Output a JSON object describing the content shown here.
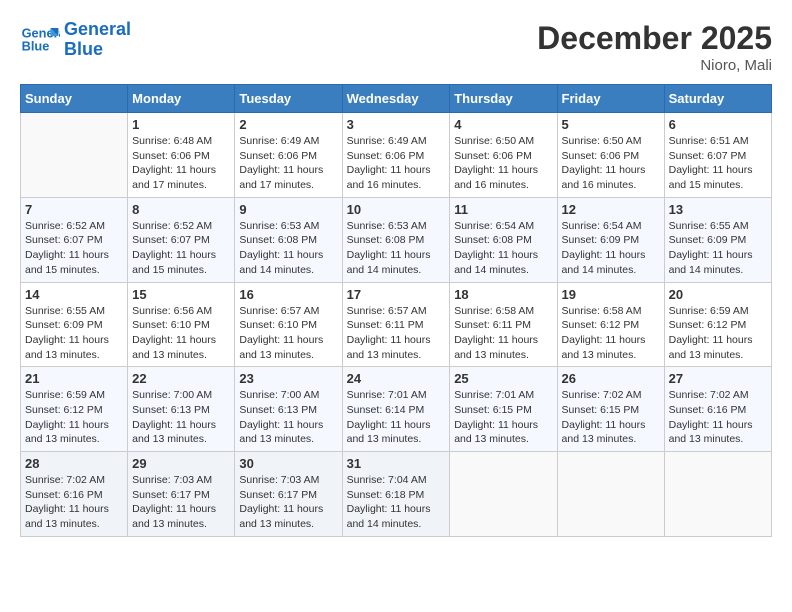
{
  "header": {
    "logo_line1": "General",
    "logo_line2": "Blue",
    "month": "December 2025",
    "location": "Nioro, Mali"
  },
  "weekdays": [
    "Sunday",
    "Monday",
    "Tuesday",
    "Wednesday",
    "Thursday",
    "Friday",
    "Saturday"
  ],
  "weeks": [
    [
      {
        "day": "",
        "sunrise": "",
        "sunset": "",
        "daylight": ""
      },
      {
        "day": "1",
        "sunrise": "Sunrise: 6:48 AM",
        "sunset": "Sunset: 6:06 PM",
        "daylight": "Daylight: 11 hours and 17 minutes."
      },
      {
        "day": "2",
        "sunrise": "Sunrise: 6:49 AM",
        "sunset": "Sunset: 6:06 PM",
        "daylight": "Daylight: 11 hours and 17 minutes."
      },
      {
        "day": "3",
        "sunrise": "Sunrise: 6:49 AM",
        "sunset": "Sunset: 6:06 PM",
        "daylight": "Daylight: 11 hours and 16 minutes."
      },
      {
        "day": "4",
        "sunrise": "Sunrise: 6:50 AM",
        "sunset": "Sunset: 6:06 PM",
        "daylight": "Daylight: 11 hours and 16 minutes."
      },
      {
        "day": "5",
        "sunrise": "Sunrise: 6:50 AM",
        "sunset": "Sunset: 6:06 PM",
        "daylight": "Daylight: 11 hours and 16 minutes."
      },
      {
        "day": "6",
        "sunrise": "Sunrise: 6:51 AM",
        "sunset": "Sunset: 6:07 PM",
        "daylight": "Daylight: 11 hours and 15 minutes."
      }
    ],
    [
      {
        "day": "7",
        "sunrise": "Sunrise: 6:52 AM",
        "sunset": "Sunset: 6:07 PM",
        "daylight": "Daylight: 11 hours and 15 minutes."
      },
      {
        "day": "8",
        "sunrise": "Sunrise: 6:52 AM",
        "sunset": "Sunset: 6:07 PM",
        "daylight": "Daylight: 11 hours and 15 minutes."
      },
      {
        "day": "9",
        "sunrise": "Sunrise: 6:53 AM",
        "sunset": "Sunset: 6:08 PM",
        "daylight": "Daylight: 11 hours and 14 minutes."
      },
      {
        "day": "10",
        "sunrise": "Sunrise: 6:53 AM",
        "sunset": "Sunset: 6:08 PM",
        "daylight": "Daylight: 11 hours and 14 minutes."
      },
      {
        "day": "11",
        "sunrise": "Sunrise: 6:54 AM",
        "sunset": "Sunset: 6:08 PM",
        "daylight": "Daylight: 11 hours and 14 minutes."
      },
      {
        "day": "12",
        "sunrise": "Sunrise: 6:54 AM",
        "sunset": "Sunset: 6:09 PM",
        "daylight": "Daylight: 11 hours and 14 minutes."
      },
      {
        "day": "13",
        "sunrise": "Sunrise: 6:55 AM",
        "sunset": "Sunset: 6:09 PM",
        "daylight": "Daylight: 11 hours and 14 minutes."
      }
    ],
    [
      {
        "day": "14",
        "sunrise": "Sunrise: 6:55 AM",
        "sunset": "Sunset: 6:09 PM",
        "daylight": "Daylight: 11 hours and 13 minutes."
      },
      {
        "day": "15",
        "sunrise": "Sunrise: 6:56 AM",
        "sunset": "Sunset: 6:10 PM",
        "daylight": "Daylight: 11 hours and 13 minutes."
      },
      {
        "day": "16",
        "sunrise": "Sunrise: 6:57 AM",
        "sunset": "Sunset: 6:10 PM",
        "daylight": "Daylight: 11 hours and 13 minutes."
      },
      {
        "day": "17",
        "sunrise": "Sunrise: 6:57 AM",
        "sunset": "Sunset: 6:11 PM",
        "daylight": "Daylight: 11 hours and 13 minutes."
      },
      {
        "day": "18",
        "sunrise": "Sunrise: 6:58 AM",
        "sunset": "Sunset: 6:11 PM",
        "daylight": "Daylight: 11 hours and 13 minutes."
      },
      {
        "day": "19",
        "sunrise": "Sunrise: 6:58 AM",
        "sunset": "Sunset: 6:12 PM",
        "daylight": "Daylight: 11 hours and 13 minutes."
      },
      {
        "day": "20",
        "sunrise": "Sunrise: 6:59 AM",
        "sunset": "Sunset: 6:12 PM",
        "daylight": "Daylight: 11 hours and 13 minutes."
      }
    ],
    [
      {
        "day": "21",
        "sunrise": "Sunrise: 6:59 AM",
        "sunset": "Sunset: 6:12 PM",
        "daylight": "Daylight: 11 hours and 13 minutes."
      },
      {
        "day": "22",
        "sunrise": "Sunrise: 7:00 AM",
        "sunset": "Sunset: 6:13 PM",
        "daylight": "Daylight: 11 hours and 13 minutes."
      },
      {
        "day": "23",
        "sunrise": "Sunrise: 7:00 AM",
        "sunset": "Sunset: 6:13 PM",
        "daylight": "Daylight: 11 hours and 13 minutes."
      },
      {
        "day": "24",
        "sunrise": "Sunrise: 7:01 AM",
        "sunset": "Sunset: 6:14 PM",
        "daylight": "Daylight: 11 hours and 13 minutes."
      },
      {
        "day": "25",
        "sunrise": "Sunrise: 7:01 AM",
        "sunset": "Sunset: 6:15 PM",
        "daylight": "Daylight: 11 hours and 13 minutes."
      },
      {
        "day": "26",
        "sunrise": "Sunrise: 7:02 AM",
        "sunset": "Sunset: 6:15 PM",
        "daylight": "Daylight: 11 hours and 13 minutes."
      },
      {
        "day": "27",
        "sunrise": "Sunrise: 7:02 AM",
        "sunset": "Sunset: 6:16 PM",
        "daylight": "Daylight: 11 hours and 13 minutes."
      }
    ],
    [
      {
        "day": "28",
        "sunrise": "Sunrise: 7:02 AM",
        "sunset": "Sunset: 6:16 PM",
        "daylight": "Daylight: 11 hours and 13 minutes."
      },
      {
        "day": "29",
        "sunrise": "Sunrise: 7:03 AM",
        "sunset": "Sunset: 6:17 PM",
        "daylight": "Daylight: 11 hours and 13 minutes."
      },
      {
        "day": "30",
        "sunrise": "Sunrise: 7:03 AM",
        "sunset": "Sunset: 6:17 PM",
        "daylight": "Daylight: 11 hours and 13 minutes."
      },
      {
        "day": "31",
        "sunrise": "Sunrise: 7:04 AM",
        "sunset": "Sunset: 6:18 PM",
        "daylight": "Daylight: 11 hours and 14 minutes."
      },
      {
        "day": "",
        "sunrise": "",
        "sunset": "",
        "daylight": ""
      },
      {
        "day": "",
        "sunrise": "",
        "sunset": "",
        "daylight": ""
      },
      {
        "day": "",
        "sunrise": "",
        "sunset": "",
        "daylight": ""
      }
    ]
  ]
}
